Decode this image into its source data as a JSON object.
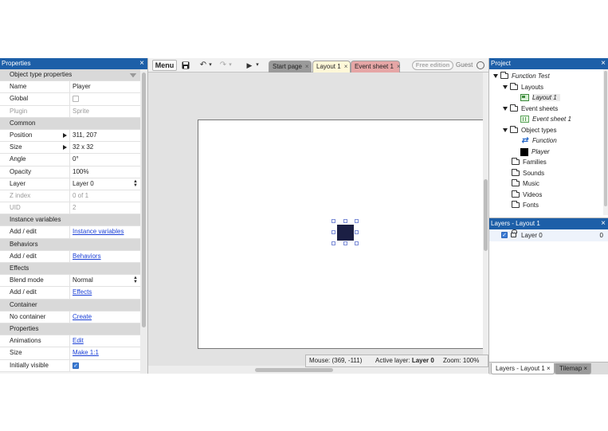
{
  "properties": {
    "title": "Properties",
    "close": "×",
    "rows": [
      {
        "type": "section",
        "label": "Object type properties"
      },
      {
        "key": "Name",
        "value": "Player"
      },
      {
        "key": "Global",
        "checkbox": false
      },
      {
        "key": "Plugin",
        "value": "Sprite",
        "dim": true
      },
      {
        "type": "section",
        "label": "Common"
      },
      {
        "key": "Position",
        "value": "311, 207",
        "expand": true
      },
      {
        "key": "Size",
        "value": "32 x 32",
        "expand": true
      },
      {
        "key": "Angle",
        "value": "0°"
      },
      {
        "key": "Opacity",
        "value": "100%"
      },
      {
        "key": "Layer",
        "value": "Layer 0",
        "select": true
      },
      {
        "key": "Z index",
        "value": "0 of 1",
        "dim": true
      },
      {
        "key": "UID",
        "value": "2",
        "dim": true
      },
      {
        "type": "section",
        "label": "Instance variables"
      },
      {
        "key": "Add / edit",
        "link": "Instance variables"
      },
      {
        "type": "section",
        "label": "Behaviors"
      },
      {
        "key": "Add / edit",
        "link": "Behaviors"
      },
      {
        "type": "section",
        "label": "Effects"
      },
      {
        "key": "Blend mode",
        "value": "Normal",
        "select": true
      },
      {
        "key": "Add / edit",
        "link": "Effects"
      },
      {
        "type": "section",
        "label": "Container"
      },
      {
        "key": "No container",
        "link": "Create"
      },
      {
        "type": "section",
        "label": "Properties"
      },
      {
        "key": "Animations",
        "link": "Edit"
      },
      {
        "key": "Size",
        "link": "Make 1:1"
      },
      {
        "key": "Initially visible",
        "checkbox": true
      }
    ]
  },
  "toolbar": {
    "menu_label": "Menu",
    "save_icon": "save-icon",
    "undo_icon": "↶",
    "redo_icon": "↷",
    "dropdown_glyph": "▾",
    "play_icon": "▶",
    "free_edition": "Free edition",
    "guest": "Guest"
  },
  "tabs": [
    {
      "label": "Start page",
      "close": "×"
    },
    {
      "label": "Layout 1",
      "close": "×"
    },
    {
      "label": "Event sheet 1",
      "close": "×"
    }
  ],
  "status": {
    "mouse": "Mouse: (369, -111)",
    "active_layer_label": "Active layer:",
    "active_layer_value": "Layer 0",
    "zoom": "Zoom: 100%"
  },
  "project": {
    "title": "Project",
    "close": "×",
    "root": "Function Test",
    "layouts_folder": "Layouts",
    "layout_item": "Layout 1",
    "event_sheets_folder": "Event sheets",
    "event_sheet_item": "Event sheet 1",
    "object_types_folder": "Object types",
    "object_function": "Function",
    "object_player": "Player",
    "families": "Families",
    "sounds": "Sounds",
    "music": "Music",
    "videos": "Videos",
    "fonts": "Fonts"
  },
  "layers": {
    "title": "Layers - Layout 1",
    "close": "×",
    "layer_name": "Layer 0",
    "layer_index": "0"
  },
  "bottom_tabs": [
    {
      "label": "Layers - Layout 1",
      "close": "×"
    },
    {
      "label": "Tilemap",
      "close": "×"
    }
  ],
  "colors": {
    "panel_title": "#1d5fa8",
    "sprite": "#1b1f44",
    "link": "#1a3fd6"
  }
}
